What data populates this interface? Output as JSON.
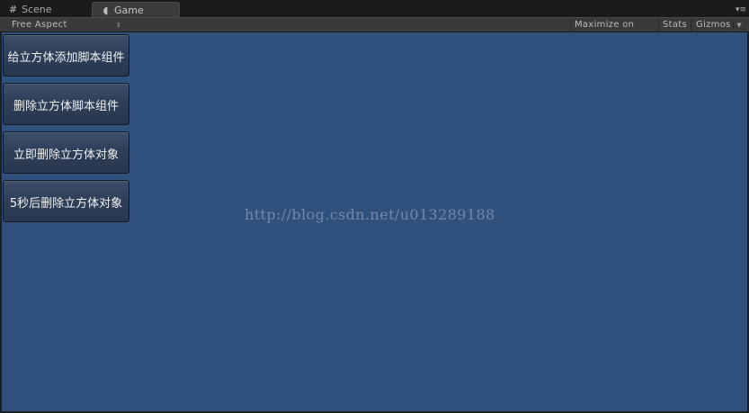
{
  "tabs": [
    {
      "label": "Scene",
      "icon": "grid-icon"
    },
    {
      "label": "Game",
      "icon": "pacman-icon"
    }
  ],
  "toolbar": {
    "aspect": "Free Aspect",
    "maximize": "Maximize on Play",
    "stats": "Stats",
    "gizmos": "Gizmos"
  },
  "game_buttons": [
    {
      "label": "给立方体添加脚本组件"
    },
    {
      "label": "删除立方体脚本组件"
    },
    {
      "label": "立即删除立方体对象"
    },
    {
      "label": "5秒后删除立方体对象"
    }
  ],
  "watermark": "http://blog.csdn.net/u013289188",
  "colors": {
    "viewport_background": "#30507d",
    "tab_bar_background": "#1b1b1b",
    "toolbar_background": "#3a3a3a"
  }
}
